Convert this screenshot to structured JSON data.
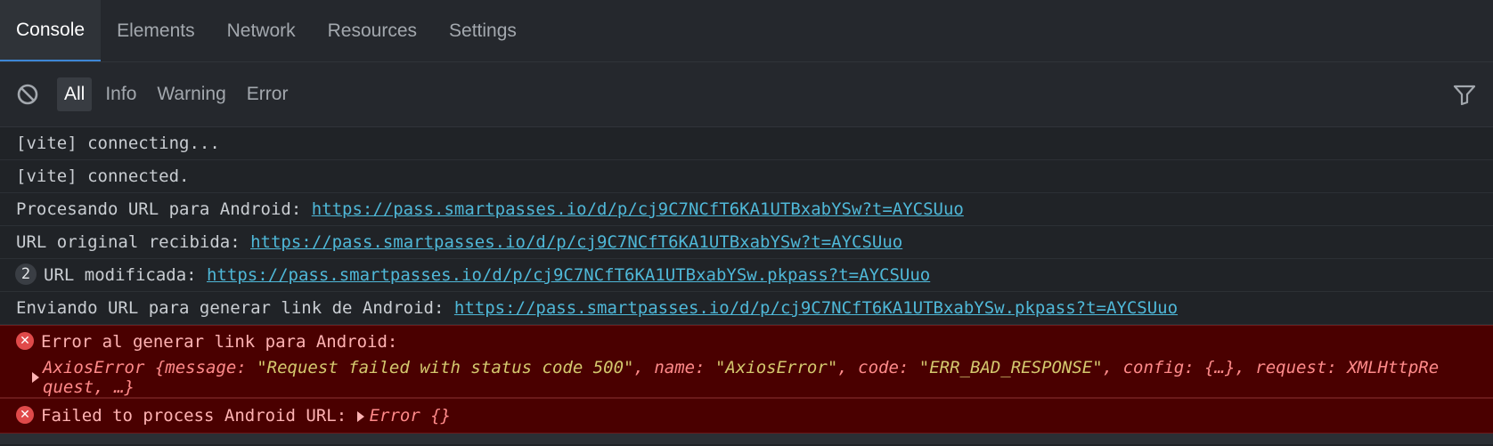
{
  "tabs": [
    "Console",
    "Elements",
    "Network",
    "Resources",
    "Settings"
  ],
  "toolbar": {
    "levels": [
      "All",
      "Info",
      "Warning",
      "Error"
    ]
  },
  "logs": {
    "l1": "[vite] connecting...",
    "l2": "[vite] connected.",
    "l3_prefix": "Procesando URL para Android: ",
    "l3_link": "https://pass.smartpasses.io/d/p/cj9C7NCfT6KA1UTBxabYSw?t=AYCSUuo",
    "l4_prefix": "URL original recibida: ",
    "l4_link": "https://pass.smartpasses.io/d/p/cj9C7NCfT6KA1UTBxabYSw?t=AYCSUuo",
    "l5_count": "2",
    "l5_prefix": "URL modificada: ",
    "l5_link": "https://pass.smartpasses.io/d/p/cj9C7NCfT6KA1UTBxabYSw.pkpass?t=AYCSUuo",
    "l6_prefix": "Enviando URL para generar link de Android: ",
    "l6_link": "https://pass.smartpasses.io/d/p/cj9C7NCfT6KA1UTBxabYSw.pkpass?t=AYCSUuo"
  },
  "errors": {
    "e1_message": "Error al generar link para Android:",
    "e1_p1": "AxiosError {message: ",
    "e1_s1": "\"Request failed with status code 500\"",
    "e1_p2": ", name: ",
    "e1_s2": "\"AxiosError\"",
    "e1_p3": ", code: ",
    "e1_s3": "\"ERR_BAD_RESPONSE\"",
    "e1_p4": ", config: {…}, request: XMLHttpRe",
    "e1_line2": "quest, …}",
    "e2_message": "Failed to process Android URL: ",
    "e2_obj": "Error {}"
  },
  "colors": {
    "link": "#4fb8d8",
    "error_bg": "#4a0000",
    "error_icon": "#e04a4a",
    "active_tab_indicator": "#3d86d6"
  },
  "icons": [
    "clear-console-icon",
    "filter-icon",
    "error-icon"
  ]
}
